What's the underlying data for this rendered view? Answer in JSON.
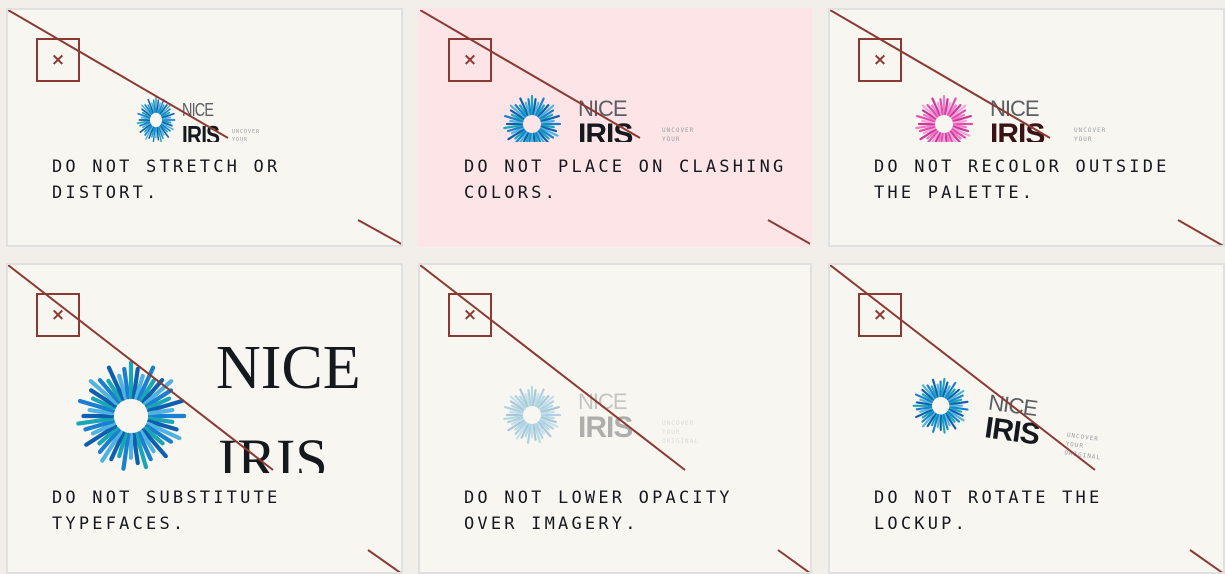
{
  "logo": {
    "nice": "NICE",
    "iris": "IRIS",
    "tagline": [
      "UNCOVER",
      "YOUR",
      "ORIGINAL"
    ]
  },
  "close_symbol": "×",
  "colors": {
    "card_bg": "#f8f6f1",
    "pink_bg": "#fde5e7",
    "accent": "#8b3a32",
    "iris_blue": "#1a7fd1",
    "iris_teal": "#19a6b5",
    "iris_pink": "#e04fb0",
    "text": "#15181d"
  },
  "cards": [
    {
      "caption": "DO NOT STRETCH OR DISTORT."
    },
    {
      "caption": "DO NOT PLACE ON CLASHING COLORS."
    },
    {
      "caption": "DO NOT RECOLOR OUTSIDE THE PALETTE."
    },
    {
      "caption": "DO NOT SUBSTITUTE TYPEFACES."
    },
    {
      "caption": "DO NOT LOWER OPACITY OVER IMAGERY."
    },
    {
      "caption": "DO NOT ROTATE THE LOCKUP."
    }
  ]
}
